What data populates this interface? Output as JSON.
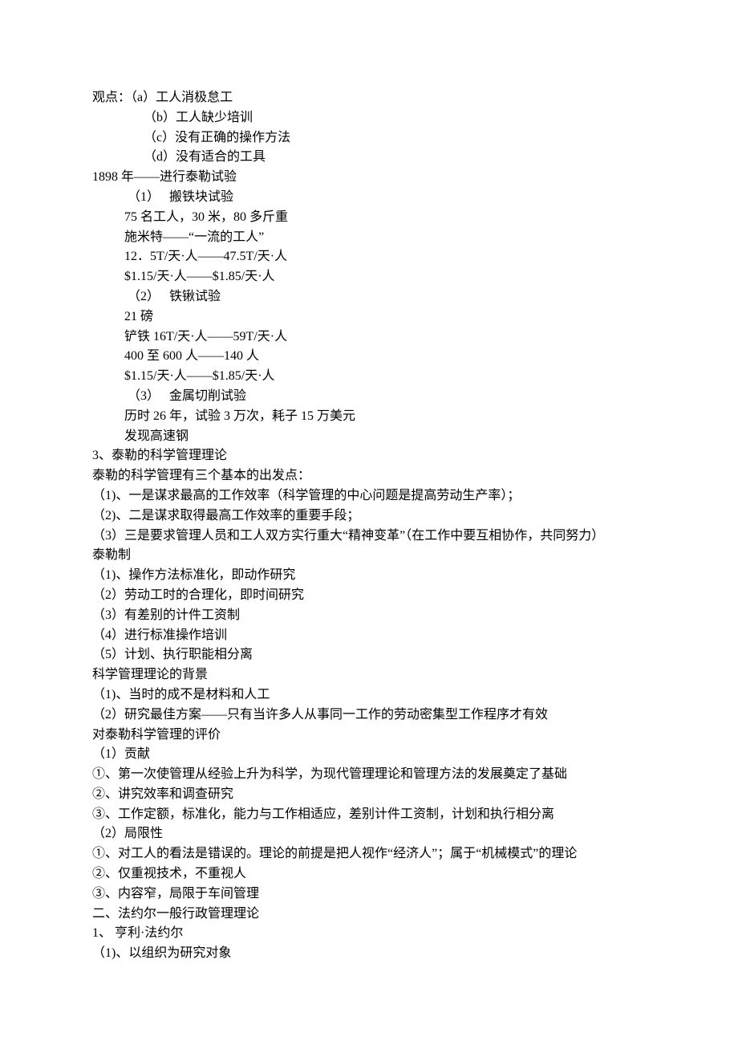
{
  "lines": [
    {
      "cls": "ind0",
      "text": "观点：（a）工人消极怠工"
    },
    {
      "cls": "ind1",
      "text": "（b）工人缺少培训"
    },
    {
      "cls": "ind1",
      "text": "（c）没有正确的操作方法"
    },
    {
      "cls": "ind1",
      "text": "（d）没有适合的工具"
    },
    {
      "cls": "ind0",
      "text": "1898 年——进行泰勒试验"
    },
    {
      "cls": "ind2",
      "text": " （1）   搬铁块试验"
    },
    {
      "cls": "ind2",
      "text": "75 名工人，30 米，80 多斤重"
    },
    {
      "cls": "ind2",
      "text": "施米特——“一流的工人”"
    },
    {
      "cls": "ind2",
      "text": "12．5T/天·人——47.5T/天·人"
    },
    {
      "cls": "ind2",
      "text": "$1.15/天·人——$1.85/天·人"
    },
    {
      "cls": "ind2",
      "text": " （2）   铁锹试验"
    },
    {
      "cls": "ind2",
      "text": "21 磅"
    },
    {
      "cls": "ind2",
      "text": "铲铁 16T/天·人——59T/天·人"
    },
    {
      "cls": "ind2",
      "text": "400 至 600 人——140 人"
    },
    {
      "cls": "ind2",
      "text": "$1.15/天·人——$1.85/天·人"
    },
    {
      "cls": "ind2",
      "text": " （3）   金属切削试验"
    },
    {
      "cls": "ind2",
      "text": "历时 26 年，试验 3 万次，耗子 15 万美元"
    },
    {
      "cls": "ind2",
      "text": "发现高速钢"
    },
    {
      "cls": "ind0",
      "text": "3、泰勒的科学管理理论"
    },
    {
      "cls": "ind0",
      "text": "泰勒的科学管理有三个基本的出发点："
    },
    {
      "cls": "ind0",
      "text": "（1)、一是谋求最高的工作效率（科学管理的中心问题是提高劳动生产率）；"
    },
    {
      "cls": "ind0",
      "text": "（2)、二是谋求取得最高工作效率的重要手段；"
    },
    {
      "cls": "ind0",
      "text": "（3）三是要求管理人员和工人双方实行重大“精神变革”（在工作中要互相协作，共同努力）"
    },
    {
      "cls": "ind0",
      "text": "泰勒制"
    },
    {
      "cls": "ind0",
      "text": "（1)、操作方法标准化，即动作研究"
    },
    {
      "cls": "ind0",
      "text": "（2）劳动工时的合理化，即时间研究"
    },
    {
      "cls": "ind0",
      "text": "（3）有差别的计件工资制"
    },
    {
      "cls": "ind0",
      "text": "（4）进行标准操作培训"
    },
    {
      "cls": "ind0",
      "text": "（5）计划、执行职能相分离"
    },
    {
      "cls": "ind0",
      "text": "科学管理理论的背景"
    },
    {
      "cls": "ind0",
      "text": "（1)、当时的成不是材料和人工"
    },
    {
      "cls": "ind0",
      "text": "（2）研究最佳方案——只有当许多人从事同一工作的劳动密集型工作程序才有效"
    },
    {
      "cls": "ind0",
      "text": "对泰勒科学管理的评价"
    },
    {
      "cls": "ind0",
      "text": "（1）贡献"
    },
    {
      "cls": "ind0",
      "text": "①、第一次使管理从经验上升为科学，为现代管理理论和管理方法的发展奠定了基础"
    },
    {
      "cls": "ind0",
      "text": "②、讲究效率和调查研究"
    },
    {
      "cls": "ind0",
      "text": "③、工作定额，标准化，能力与工作相适应，差别计件工资制，计划和执行相分离"
    },
    {
      "cls": "ind0",
      "text": "（2）局限性"
    },
    {
      "cls": "ind0",
      "text": "①、对工人的看法是错误的。理论的前提是把人视作“经济人”；属于“机械模式”的理论"
    },
    {
      "cls": "ind0",
      "text": "②、仅重视技术，不重视人"
    },
    {
      "cls": "ind0",
      "text": "③、内容窄，局限于车间管理"
    },
    {
      "cls": "ind0",
      "text": "二、法约尔一般行政管理理论"
    },
    {
      "cls": "ind0",
      "text": "1、 亨利·法约尔"
    },
    {
      "cls": "ind0",
      "text": "（1)、以组织为研究对象"
    }
  ]
}
